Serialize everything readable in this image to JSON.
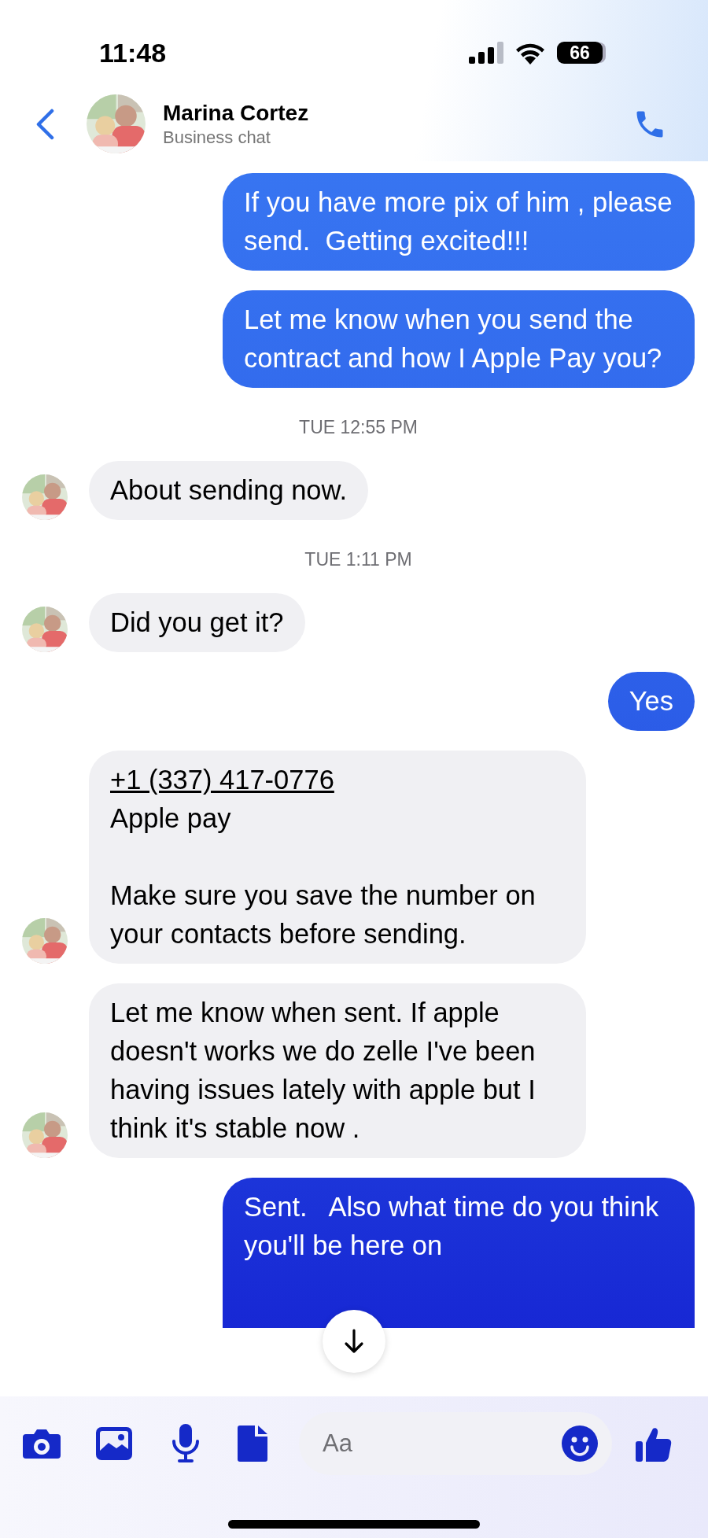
{
  "status_bar": {
    "time": "11:48",
    "battery": "66"
  },
  "header": {
    "name": "Marina Cortez",
    "subtitle": "Business chat"
  },
  "messages": [
    {
      "kind": "outgoing",
      "text": "If you have more pix of him , please send.  Getting excited!!!"
    },
    {
      "kind": "outgoing",
      "text": "Let me know when you send the contract and how I Apple Pay you?"
    },
    {
      "kind": "timestamp",
      "text": "TUE 12:55 PM"
    },
    {
      "kind": "incoming",
      "text": "About sending now.",
      "avatar": true
    },
    {
      "kind": "timestamp",
      "text": "TUE 1:11 PM"
    },
    {
      "kind": "incoming",
      "text": "Did you get it?",
      "avatar": true
    },
    {
      "kind": "outgoing",
      "text": "Yes"
    },
    {
      "kind": "incoming",
      "link": "+1 (337) 417-0776",
      "text": "Apple pay\n\nMake sure you save the number on your contacts before sending.",
      "avatar": true
    },
    {
      "kind": "incoming",
      "text": "Let me know when sent. If apple doesn't works we do zelle I've been having issues lately with apple but I think it's stable now .",
      "avatar": true
    },
    {
      "kind": "outgoing",
      "text": "Sent.   Also what time do you think you'll be here on",
      "clipped": true
    }
  ],
  "composer": {
    "placeholder": "Aa"
  }
}
